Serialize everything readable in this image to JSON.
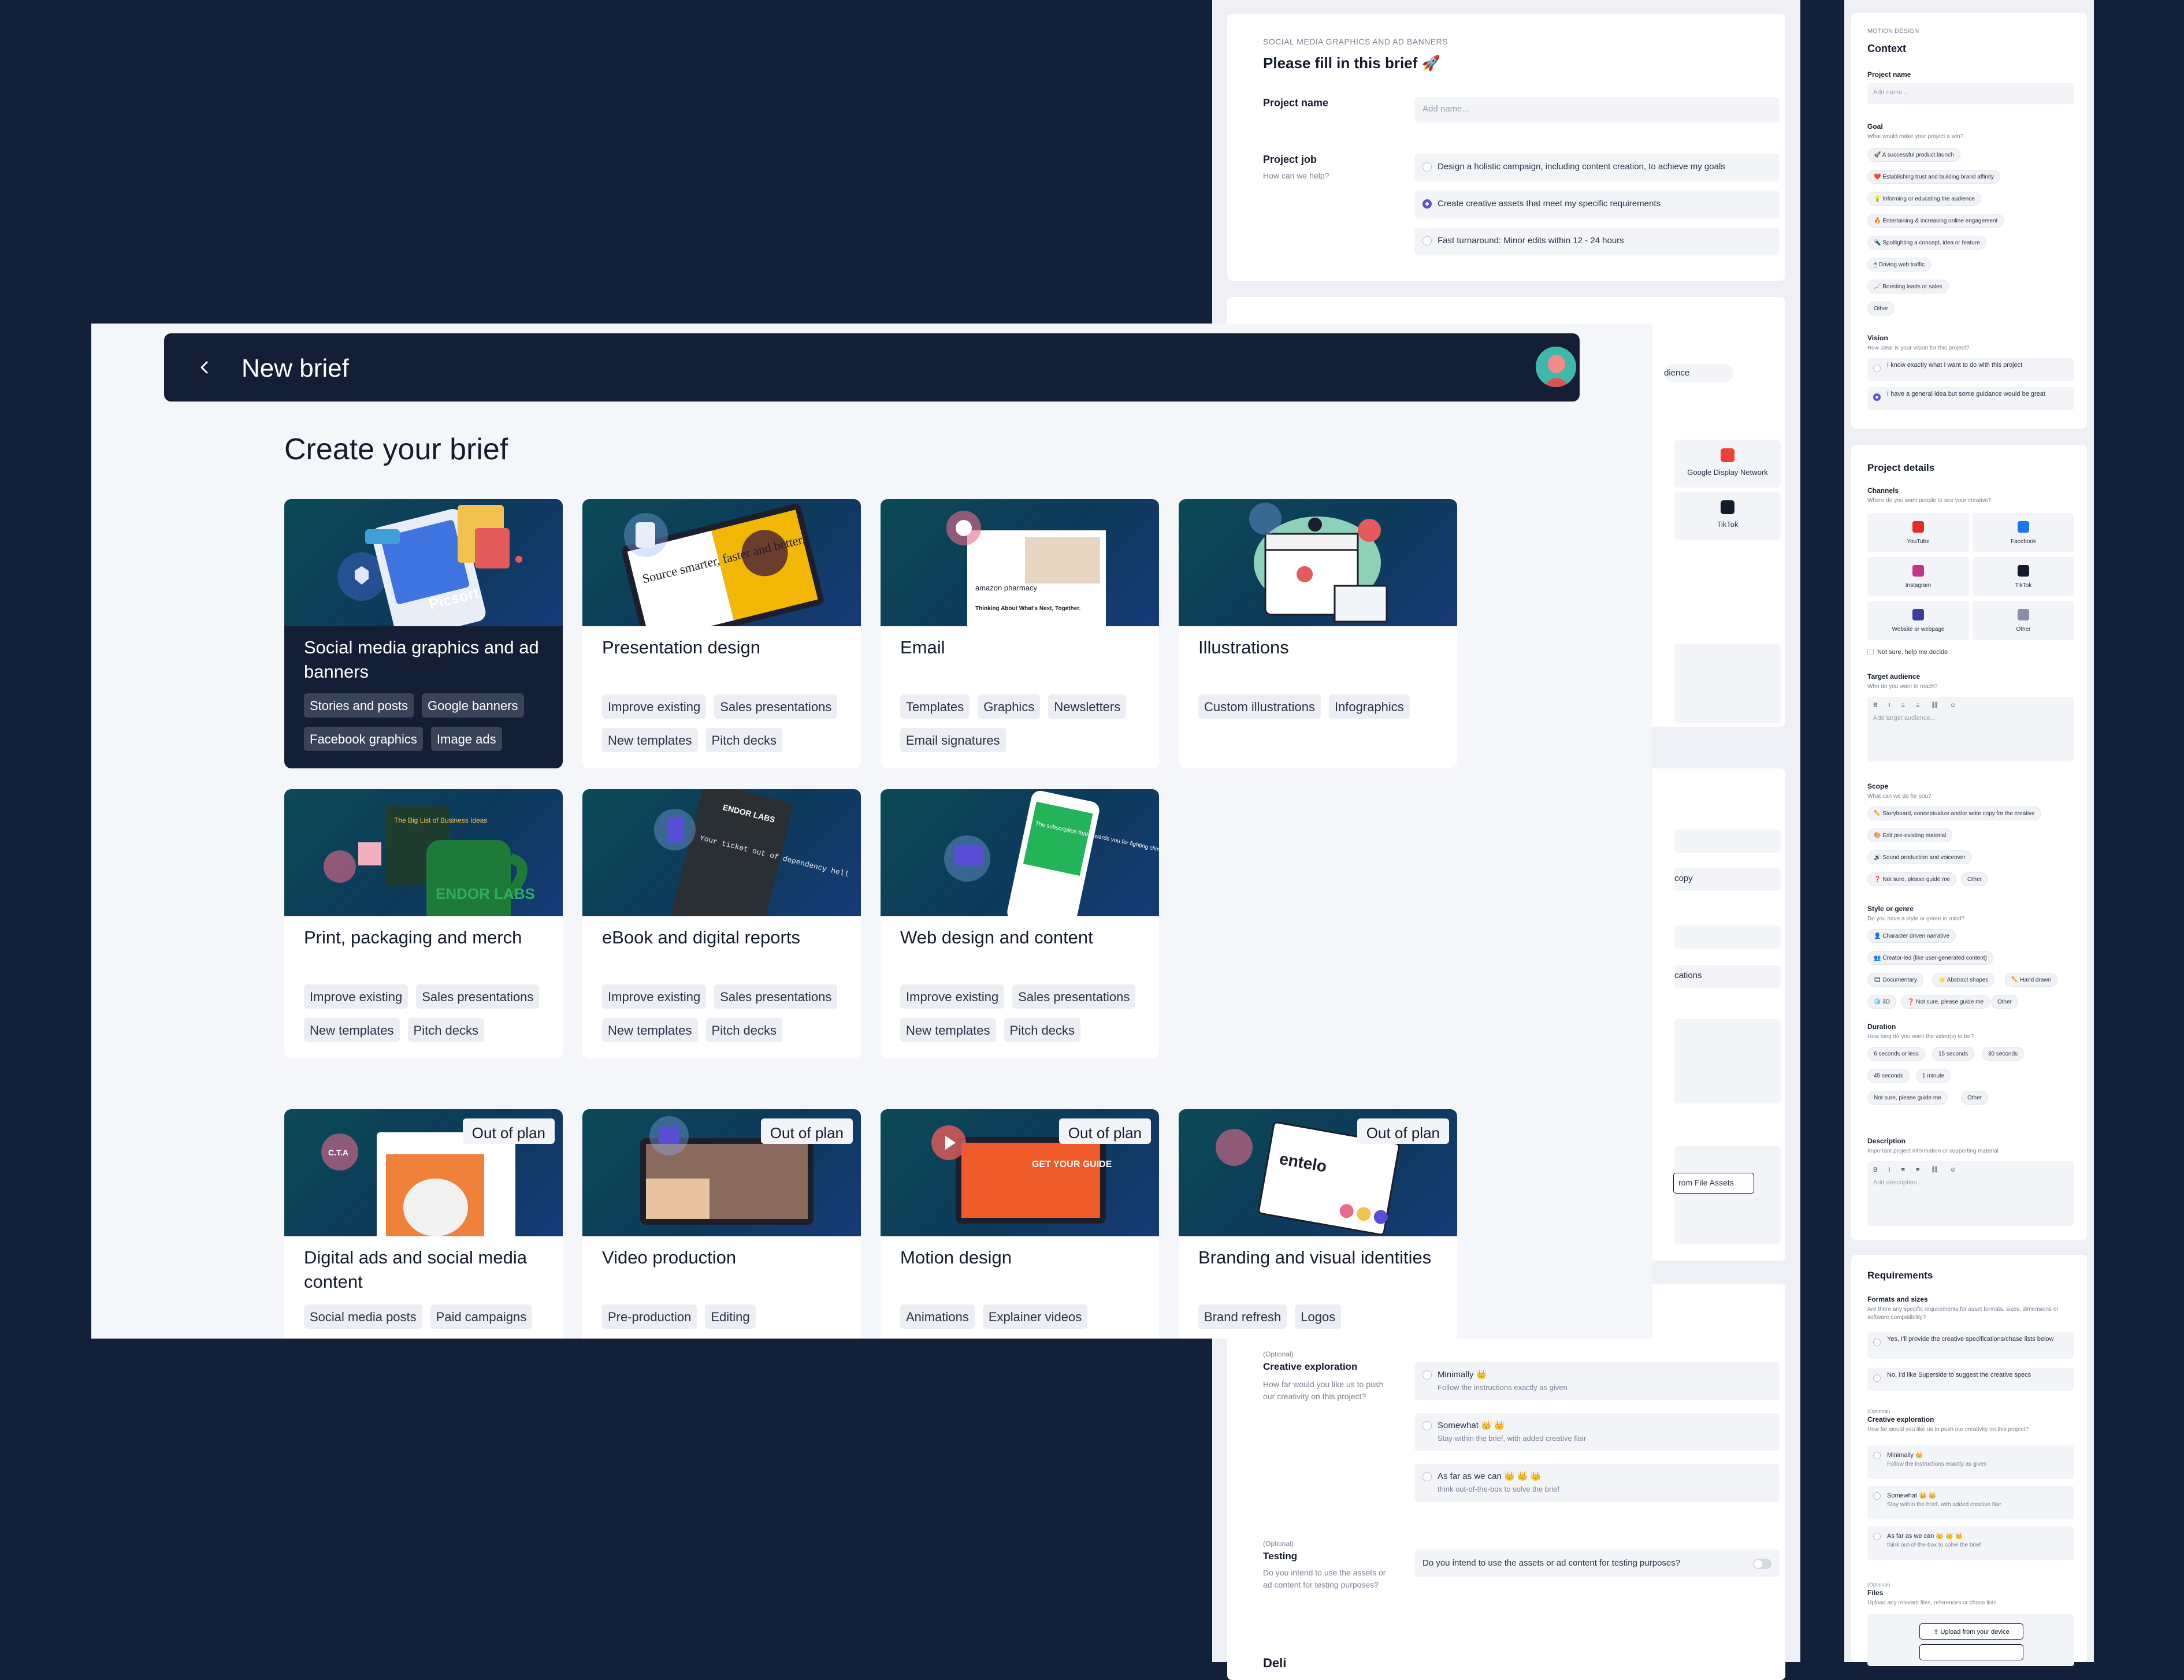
{
  "middle_panel": {
    "eyebrow": "SOCIAL MEDIA GRAPHICS AND AD BANNERS",
    "title": "Please fill in this brief 🚀",
    "project_name_label": "Project name",
    "project_name_placeholder": "Add name...",
    "project_job_label": "Project job",
    "project_job_sub": "How can we help?",
    "job_options": [
      "Design a holistic campaign, including content creation, to achieve my goals",
      "Create creative assets that meet my specific requirements",
      "Fast turnaround: Minor edits within 12 - 24 hours"
    ],
    "fragments": [
      "dience",
      "Google Display Network",
      "TikTok",
      "copy",
      "cations",
      "rom File Assets"
    ],
    "optional_label": "(Optional)",
    "creative_exploration_label": "Creative exploration",
    "creative_exploration_sub": "How far would you like us to push our creativity on this project?",
    "creative_options": [
      {
        "title": "Minimally 👑",
        "desc": "Follow the instructions exactly as given"
      },
      {
        "title": "Somewhat 👑 👑",
        "desc": "Stay within the brief, with added creative flair"
      },
      {
        "title": "As far as we can 👑 👑 👑",
        "desc": "think out-of-the-box to solve the brief"
      }
    ],
    "testing_optional": "(Optional)",
    "testing_label": "Testing",
    "testing_sub": "Do you intend to use the assets or ad content for testing purposes?",
    "testing_question": "Do you intend to use the assets or ad content for testing purposes?",
    "bottom_label": "Deli"
  },
  "right_panel": {
    "eyebrow": "MOTION DESIGN",
    "context_title": "Context",
    "project_name_label": "Project name",
    "project_name_placeholder": "Add name...",
    "goal_label": "Goal",
    "goal_sub": "What would make your project a win?",
    "goal_chips": [
      "🚀 A successful product launch",
      "❤️ Establishing trust and building brand affinity",
      "💡 Informing or educating the audience",
      "🔥 Entertaining & increasing online engagement",
      "🔦 Spotlighting a concept, idea or feature",
      "🖱 Driving web traffic",
      "📈 Boosting leads or sales",
      "Other"
    ],
    "vision_label": "Vision",
    "vision_sub": "How clear is your vision for this project?",
    "vision_options": [
      "I know exactly what I want to do with this project",
      "I have a general idea but some guidance would be great"
    ],
    "project_details_title": "Project details",
    "channels_label": "Channels",
    "channels_sub": "Where do you want people to see your creative?",
    "channels": [
      "YouTube",
      "Facebook",
      "Instagram",
      "TikTok",
      "Website or webpage",
      "Other"
    ],
    "not_sure_decide": "Not sure, help me decide",
    "target_label": "Target audience",
    "target_sub": "Who do you want to reach?",
    "toolbar": "B I ≡ ≡ ⛓ ☺",
    "target_placeholder": "Add target audience...",
    "scope_label": "Scope",
    "scope_sub": "What can we do for you?",
    "scope_chips": [
      "✏️ Storyboard, conceptualize and/or write copy for the creative",
      "🎨 Edit pre-existing material",
      "🔊 Sound production and voiceover",
      "❓ Not sure, please guide me",
      "Other"
    ],
    "style_label": "Style or genre",
    "style_sub": "Do you have a style or genre in mind?",
    "style_chips": [
      "👤 Character driven narrative",
      "👥 Creator-led (like user-generated content)",
      "🎞 Documentary",
      "⭐ Abstract shapes",
      "✏️ Hand drawn",
      "🧊 3D",
      "❓ Not sure, please guide me",
      "Other"
    ],
    "duration_label": "Duration",
    "duration_sub": "How long do you want the video(s) to be?",
    "duration_chips": [
      "6 seconds or less",
      "15 seconds",
      "30 seconds",
      "45 seconds",
      "1 minute",
      "Not sure, please guide me",
      "Other"
    ],
    "description_label": "Description",
    "description_sub": "Important project information or supporting material",
    "description_placeholder": "Add description...",
    "requirements_title": "Requirements",
    "formats_label": "Formats and sizes",
    "formats_sub": "Are there any specific requirements for asset formats, sizes, dimensions or software compatibility?",
    "formats_options": [
      "Yes, I'll provide the creative specifications/chase lists below",
      "No, I'd like Superside to suggest the creative specs"
    ],
    "optional_label": "(Optional)",
    "creative_label": "Creative exploration",
    "creative_sub": "How far would you like us to push our creativity on this project?",
    "creative_options": [
      {
        "title": "Minimally 👑",
        "desc": "Follow the instructions exactly as given"
      },
      {
        "title": "Somewhat 👑 👑",
        "desc": "Stay within the brief, with added creative flair"
      },
      {
        "title": "As far as we can 👑 👑 👑",
        "desc": "think out-of-the-box to solve the brief"
      }
    ],
    "files_optional": "(Optional)",
    "files_label": "Files",
    "files_sub": "Upload any relevant files, references or chase lists",
    "upload_button": "⇪ Upload from your device"
  },
  "main": {
    "top_title": "New brief",
    "heading": "Create your brief",
    "cards": [
      {
        "title": "Social media graphics and ad banners",
        "tags": [
          "Stories and posts",
          "Google banners",
          "Facebook graphics",
          "Image ads"
        ],
        "selected": true
      },
      {
        "title": "Presentation design",
        "tags": [
          "Improve existing",
          "Sales presentations",
          "New templates",
          "Pitch decks"
        ]
      },
      {
        "title": "Email",
        "tags": [
          "Templates",
          "Graphics",
          "Newsletters",
          "Email signatures"
        ]
      },
      {
        "title": "Illustrations",
        "tags": [
          "Custom illustrations",
          "Infographics"
        ]
      },
      {
        "title": "Print, packaging and merch",
        "tags": [
          "Improve existing",
          "Sales presentations",
          "New templates",
          "Pitch decks"
        ]
      },
      {
        "title": "eBook and digital reports",
        "tags": [
          "Improve existing",
          "Sales presentations",
          "New templates",
          "Pitch decks"
        ]
      },
      {
        "title": "Web design and content",
        "tags": [
          "Improve existing",
          "Sales presentations",
          "New templates",
          "Pitch decks"
        ]
      },
      {
        "title": "Digital ads and social media content",
        "tags": [
          "Social media posts",
          "Paid campaigns"
        ],
        "badge": "Out of plan"
      },
      {
        "title": "Video production",
        "tags": [
          "Pre-production",
          "Editing"
        ],
        "badge": "Out of plan"
      },
      {
        "title": "Motion design",
        "tags": [
          "Animations",
          "Explainer videos"
        ],
        "badge": "Out of plan"
      },
      {
        "title": "Branding and visual identities",
        "tags": [
          "Brand refresh",
          "Logos"
        ],
        "badge": "Out of plan"
      }
    ],
    "image_text": {
      "picsort": "Picsort",
      "deck": "Source smarter, faster and better.",
      "amazon": "amazon pharmacy",
      "email_head": "Thinking About What's Next, Together.",
      "book": "The Big List of Business Ideas",
      "mug": "ENDOR LABS",
      "ebook": "Your ticket out of dependency hell",
      "ebook_brand": "ENDOR LABS",
      "phone": "The subscription that rewards you for fighting climate change.",
      "guide": "GET YOUR GUIDE",
      "entelo": "entelo",
      "cta": "C.T.A"
    }
  },
  "colors": {
    "page_bg": "#12203a",
    "bar_bg": "#141f35",
    "accent": "#5b4ed6",
    "teal": "#3fb7a9"
  }
}
